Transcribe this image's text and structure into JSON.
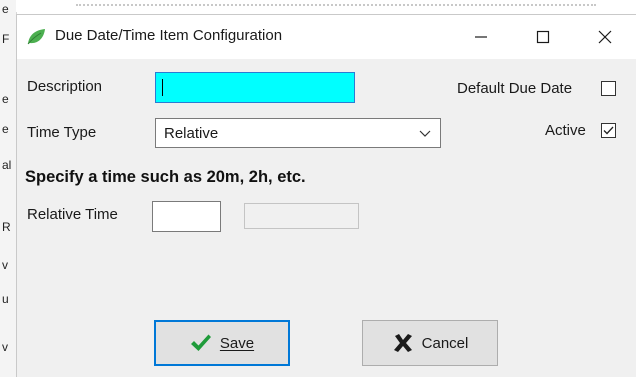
{
  "background": {
    "edge_chars": [
      "e",
      "F",
      "e",
      "e",
      "al",
      "R",
      "v",
      "u",
      "v"
    ]
  },
  "window": {
    "title": "Due Date/Time Item Configuration",
    "icon": "leaf-icon",
    "controls": {
      "minimize": "—",
      "maximize": "☐",
      "close": "✕"
    }
  },
  "form": {
    "description_label": "Description",
    "description_value": "",
    "default_due_date_label": "Default Due Date",
    "default_due_date_checked": false,
    "time_type_label": "Time Type",
    "time_type_value": "Relative",
    "active_label": "Active",
    "active_checked": true,
    "hint": "Specify a time such as 20m, 2h, etc.",
    "relative_time_label": "Relative Time",
    "relative_time_value": "",
    "relative_time_display": ""
  },
  "buttons": {
    "save_label": "Save",
    "cancel_label": "Cancel"
  },
  "colors": {
    "description_bg": "#00ffff",
    "focus_border": "#0078d7",
    "save_icon": "#1f9b3a",
    "cancel_icon": "#1a1a1a",
    "leaf_icon": "#4caf50"
  }
}
